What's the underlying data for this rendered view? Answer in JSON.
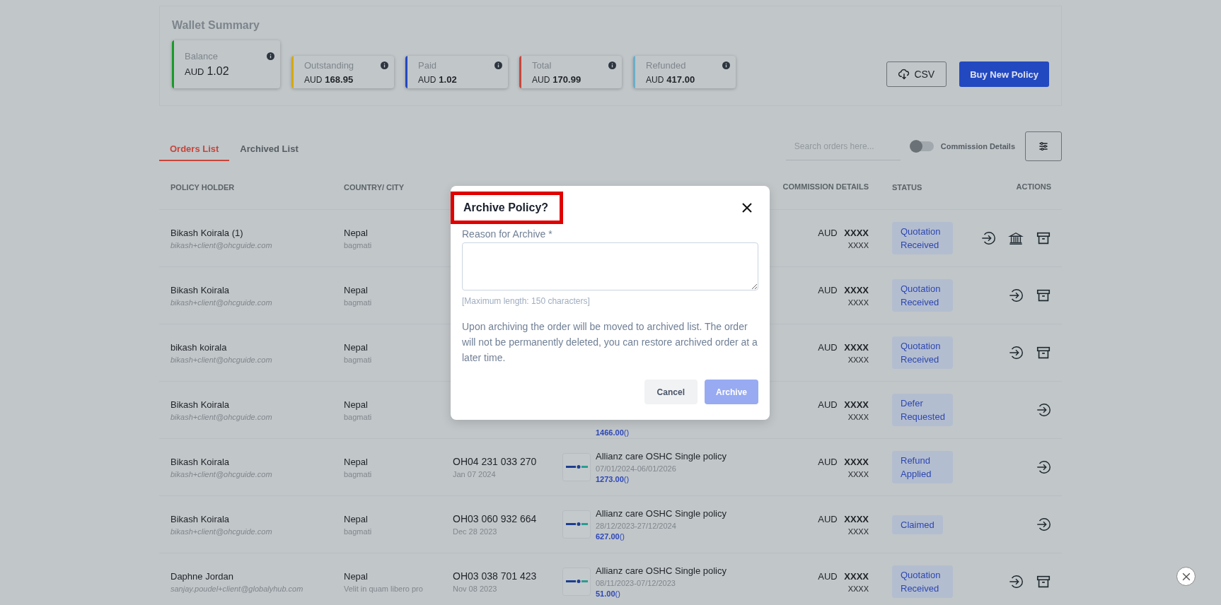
{
  "wallet": {
    "title": "Wallet Summary",
    "cards": [
      {
        "label": "Balance",
        "currency": "AUD",
        "amount": "1.02",
        "color": "#1a9a2a",
        "featured": true
      },
      {
        "label": "Outstanding",
        "currency": "AUD",
        "amount": "168.95",
        "color": "#d4a90c",
        "featured": false
      },
      {
        "label": "Paid",
        "currency": "AUD",
        "amount": "1.02",
        "color": "#2447c0",
        "featured": false
      },
      {
        "label": "Total",
        "currency": "AUD",
        "amount": "170.99",
        "color": "#c8473c",
        "featured": false
      },
      {
        "label": "Refunded",
        "currency": "AUD",
        "amount": "417.00",
        "color": "#6aaec8",
        "featured": false
      }
    ],
    "csv_button": "CSV",
    "buy_button": "Buy New Policy"
  },
  "tabs": [
    {
      "label": "Orders List",
      "selected": true
    },
    {
      "label": "Archived List",
      "selected": false
    }
  ],
  "search": {
    "placeholder": "Search orders here..."
  },
  "commission_toggle": {
    "label": "Commission Details",
    "on": false
  },
  "table": {
    "columns": [
      "POLICY HOLDER",
      "COUNTRY/ CITY",
      "COMMISSION DETAILS",
      "STATUS",
      "ACTIONS"
    ],
    "rows": [
      {
        "name": "Bikash Koirala (1)",
        "email": "bikash+client@ohcguide.com",
        "country": "Nepal",
        "city": "bagmati",
        "commission_currency": "AUD",
        "commission": "XXXX",
        "commission_sub": "XXXX",
        "status": "Quotation Received",
        "actions": [
          {
            "kind": "view"
          },
          {
            "kind": "bank"
          },
          {
            "kind": "archive"
          }
        ]
      },
      {
        "name": "Bikash Koirala",
        "email": "bikash+client@ohcguide.com",
        "country": "Nepal",
        "city": "bagmati",
        "commission_currency": "AUD",
        "commission": "XXXX",
        "commission_sub": "XXXX",
        "status": "Quotation Received",
        "actions": [
          {
            "kind": "view"
          },
          {
            "kind": "archive"
          }
        ]
      },
      {
        "name": "bikash koirala",
        "email": "bikash+client@ohcguide.com",
        "country": "Nepal",
        "city": "bagmati",
        "commission_currency": "AUD",
        "commission": "XXXX",
        "commission_sub": "XXXX",
        "status": "Quotation Received",
        "actions": [
          {
            "kind": "view"
          },
          {
            "kind": "archive"
          }
        ]
      },
      {
        "name": "Bikash Koirala",
        "email": "bikash+client@ohcguide.com",
        "country": "Nepal",
        "city": "bagmati",
        "product": {
          "price": "1466.00",
          "price_note": "()"
        },
        "commission_currency": "AUD",
        "commission": "XXXX",
        "commission_sub": "XXXX",
        "status": "Defer Requested",
        "actions": [
          {
            "kind": "view"
          }
        ]
      },
      {
        "name": "Bikash Koirala",
        "email": "bikash+client@ohcguide.com",
        "country": "Nepal",
        "city": "bagmati",
        "policy_number": "OH04 231 033 270",
        "date": "Jan 07 2024",
        "product": {
          "name": "Allianz care OSHC Single policy",
          "period": "07/01/2024-06/01/2026",
          "price": "1273.00",
          "price_note": "()"
        },
        "commission_currency": "AUD",
        "commission": "XXXX",
        "commission_sub": "XXXX",
        "status": "Refund Applied",
        "actions": [
          {
            "kind": "view"
          }
        ]
      },
      {
        "name": "Bikash Koirala",
        "email": "bikash+client@ohcguide.com",
        "country": "Nepal",
        "city": "bagmati",
        "policy_number": "OH03 060 932 664",
        "date": "Dec 28 2023",
        "product": {
          "name": "Allianz care OSHC Single policy",
          "period": "28/12/2023-27/12/2024",
          "price": "627.00",
          "price_note": "()"
        },
        "commission_currency": "AUD",
        "commission": "XXXX",
        "commission_sub": "XXXX",
        "status": "Claimed",
        "actions": [
          {
            "kind": "view"
          }
        ]
      },
      {
        "name": "Daphne Jordan",
        "email": "sanjay.poudel+client@globalyhub.com",
        "country": "Nepal",
        "city": "Velit in quam libero pro",
        "policy_number": "OH03 038 701 423",
        "date": "Nov 08 2023",
        "product": {
          "name": "Allianz care OSHC Single policy",
          "period": "08/11/2023-07/12/2023",
          "price": "51.00",
          "price_note": "()"
        },
        "commission_currency": "AUD",
        "commission": "XXXX",
        "commission_sub": "XXXX",
        "status": "Quotation Received",
        "actions": [
          {
            "kind": "view"
          },
          {
            "kind": "archive"
          }
        ]
      }
    ]
  },
  "modal": {
    "title": "Archive Policy?",
    "title_highlighted": true,
    "field_label": "Reason for Archive *",
    "hint": "[Maximum length: 150 characters]",
    "message": "Upon archiving the order will be moved to archived list. The order will not be permanently deleted, you can restore archived order at a later time.",
    "cancel": "Cancel",
    "confirm": {
      "label": "Archive",
      "disabled": true
    }
  }
}
